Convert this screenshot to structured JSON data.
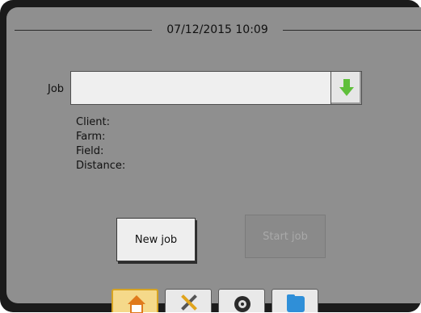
{
  "datetime": "07/12/2015 10:09",
  "job": {
    "label": "Job",
    "value": ""
  },
  "info": {
    "client_label": "Client:",
    "farm_label": "Farm:",
    "field_label": "Field:",
    "distance_label": "Distance:"
  },
  "buttons": {
    "new_job": "New job",
    "start_job": "Start job"
  },
  "tabs": [
    {
      "icon": "home-icon",
      "active": true
    },
    {
      "icon": "tools-icon",
      "active": false
    },
    {
      "icon": "target-icon",
      "active": false
    },
    {
      "icon": "folder-icon",
      "active": false
    }
  ],
  "colors": {
    "panel_bg": "#8f8f8f",
    "frame": "#1b1b1b",
    "arrow_green": "#5fbf3a",
    "active_tab": "#f5d98a"
  }
}
